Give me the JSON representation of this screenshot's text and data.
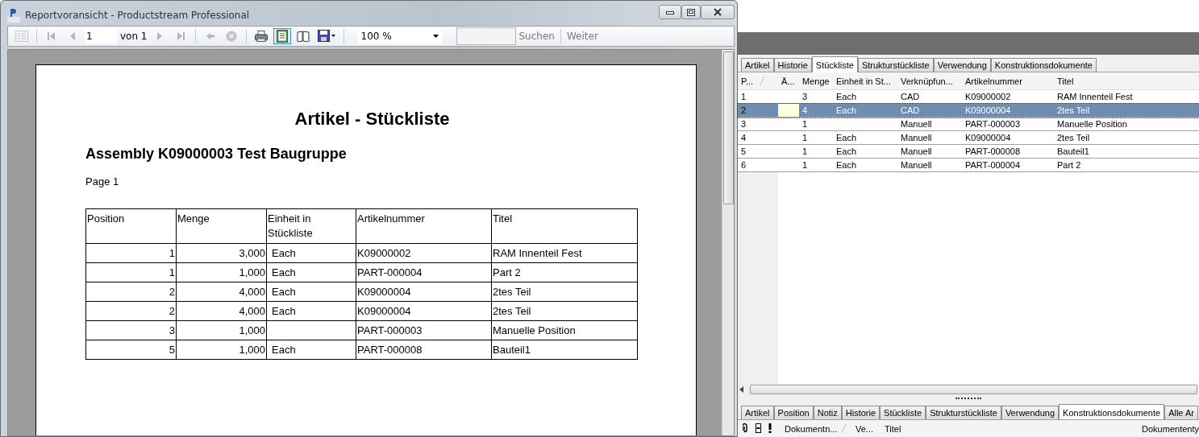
{
  "window": {
    "title": "Reportvoransicht - Productstream Professional"
  },
  "toolbar": {
    "items": [
      {
        "kind": "docmap",
        "disabled": true
      },
      {
        "kind": "sep"
      },
      {
        "kind": "first",
        "disabled": true
      },
      {
        "kind": "prev",
        "disabled": true
      },
      {
        "kind": "page"
      },
      {
        "kind": "next",
        "disabled": true
      },
      {
        "kind": "last",
        "disabled": true
      },
      {
        "kind": "sep"
      },
      {
        "kind": "back",
        "disabled": true
      },
      {
        "kind": "stop",
        "disabled": true
      },
      {
        "kind": "sep"
      },
      {
        "kind": "print",
        "disabled": false
      },
      {
        "kind": "layout",
        "disabled": false,
        "selected": true
      },
      {
        "kind": "pagesetup",
        "disabled": false,
        "selected": false
      },
      {
        "kind": "save",
        "disabled": false
      },
      {
        "kind": "sep"
      },
      {
        "kind": "zoom"
      },
      {
        "kind": "search"
      }
    ],
    "page_value": "1",
    "page_of": "von 1",
    "zoom": "100 %",
    "find": "Suchen",
    "next": "Weiter"
  },
  "report": {
    "title": "Artikel - Stückliste",
    "subtitle": "Assembly K09000003 Test Baugruppe",
    "page": "Page 1",
    "columns": [
      "Position",
      "Menge",
      "Einheit in Stückliste",
      "Artikelnummer",
      "Titel"
    ],
    "rows": [
      [
        "1",
        "3,000",
        "Each",
        "K09000002",
        "RAM Innenteil Fest"
      ],
      [
        "1",
        "1,000",
        "Each",
        "PART-000004",
        "Part 2"
      ],
      [
        "2",
        "4,000",
        "Each",
        "K09000004",
        "2tes Teil"
      ],
      [
        "2",
        "4,000",
        "Each",
        "K09000004",
        "2tes Teil"
      ],
      [
        "3",
        "1,000",
        "",
        "PART-000003",
        "Manuelle Position"
      ],
      [
        "5",
        "1,000",
        "Each",
        "PART-000008",
        "Bauteil1"
      ]
    ]
  },
  "top_tabs": [
    {
      "label": "Artikel",
      "selected": false
    },
    {
      "label": "Historie",
      "selected": false
    },
    {
      "label": "Stückliste",
      "selected": true
    },
    {
      "label": "Strukturstückliste",
      "selected": false
    },
    {
      "label": "Verwendung",
      "selected": false
    },
    {
      "label": "Konstruktionsdokumente",
      "selected": false
    }
  ],
  "grid": {
    "columns": [
      "P...",
      "Ä...",
      "Menge",
      "Einheit in St...",
      "Verknüpfun...",
      "Artikelnummer",
      "Titel"
    ],
    "rows": [
      {
        "cells": [
          "1",
          "",
          "3",
          "Each",
          "CAD",
          "K09000002",
          "RAM Innenteil Fest"
        ],
        "selected": false
      },
      {
        "cells": [
          "2",
          "",
          "4",
          "Each",
          "CAD",
          "K09000004",
          "2tes Teil"
        ],
        "selected": true
      },
      {
        "cells": [
          "3",
          "",
          "1",
          "",
          "Manuell",
          "PART-000003",
          "Manuelle Position"
        ],
        "selected": false
      },
      {
        "cells": [
          "4",
          "",
          "1",
          "Each",
          "Manuell",
          "K09000004",
          "2tes Teil"
        ],
        "selected": false
      },
      {
        "cells": [
          "5",
          "",
          "1",
          "Each",
          "Manuell",
          "PART-000008",
          "Bauteil1"
        ],
        "selected": false
      },
      {
        "cells": [
          "6",
          "",
          "1",
          "Each",
          "Manuell",
          "PART-000004",
          "Part 2"
        ],
        "selected": false
      }
    ]
  },
  "bottom_tabs": [
    {
      "label": "Artikel",
      "selected": false
    },
    {
      "label": "Position",
      "selected": false
    },
    {
      "label": "Notiz",
      "selected": false
    },
    {
      "label": "Historie",
      "selected": false
    },
    {
      "label": "Stückliste",
      "selected": false
    },
    {
      "label": "Strukturstückliste",
      "selected": false
    },
    {
      "label": "Verwendung",
      "selected": false
    },
    {
      "label": "Konstruktionsdokumente",
      "selected": true
    },
    {
      "label": "Alle Ar",
      "selected": false
    }
  ],
  "bottom_grid": {
    "columns": [
      {
        "kind": "clip"
      },
      {
        "kind": "lock"
      },
      {
        "kind": "alert"
      },
      {
        "kind": "text",
        "label": "Dokumentn...",
        "sorted": true
      },
      {
        "kind": "text",
        "label": "Ve..."
      },
      {
        "kind": "wide",
        "label": "Titel"
      },
      {
        "kind": "text",
        "label": "Dokumententy"
      }
    ]
  }
}
